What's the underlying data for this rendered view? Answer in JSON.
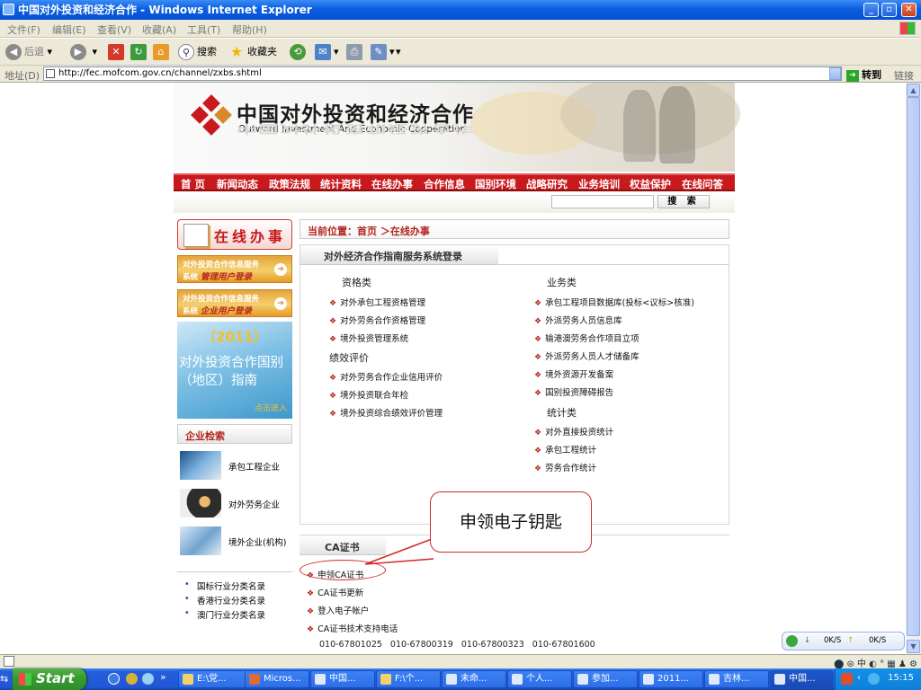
{
  "window": {
    "title": "中国对外投资和经济合作 - Windows Internet Explorer",
    "min": "_",
    "max": "▫",
    "close": "✕"
  },
  "menubar": [
    "文件(F)",
    "编辑(E)",
    "查看(V)",
    "收藏(A)",
    "工具(T)",
    "帮助(H)"
  ],
  "toolbar": {
    "back": "后退",
    "search": "搜索",
    "favorites": "收藏夹"
  },
  "address": {
    "label": "地址(D)",
    "url": "http://fec.mofcom.gov.cn/channel/zxbs.shtml",
    "go": "转到",
    "links": "链接"
  },
  "site": {
    "title_cn": "中国对外投资和经济合作",
    "title_en": "Outward Investment And Economic Cooperation",
    "nav": [
      "首 页",
      "新闻动态",
      "政策法规",
      "统计资料",
      "在线办事",
      "合作信息",
      "国别环境",
      "战略研究",
      "业务培训",
      "权益保护",
      "在线问答"
    ],
    "search_button": "搜 索"
  },
  "left": {
    "online_header": "在线办事",
    "login_manager": {
      "line1": "对外投资合作信息服务",
      "prefix": "系统",
      "emph": "管理用户登录"
    },
    "login_enterprise": {
      "line1": "对外投资合作信息服务",
      "prefix": "系统",
      "emph": "企业用户登录"
    },
    "guide": {
      "year": "（2011）",
      "line1": "对外投资合作国别",
      "line2": "（地区）指南",
      "more": "点击进入"
    },
    "enterprise_search": "企业检索",
    "enterprise_items": [
      "承包工程企业",
      "对外劳务企业",
      "境外企业(机构)"
    ],
    "categories": [
      "国标行业分类名录",
      "香港行业分类名录",
      "澳门行业分类名录"
    ]
  },
  "main": {
    "breadcrumb": "当前位置：首页 ＞在线办事",
    "panel_title": "对外经济合作指南服务系统登录",
    "qualification_title": "资格类",
    "qualification": [
      "对外承包工程资格管理",
      "对外劳务合作资格管理",
      "境外投资管理系统"
    ],
    "performance_title": "绩效评价",
    "performance": [
      "对外劳务合作企业信用评价",
      "境外投资联合年检",
      "境外投资综合绩效评价管理"
    ],
    "business_title": "业务类",
    "business": [
      "承包工程项目数据库(投标<议标>核准)",
      "外派劳务人员信息库",
      "输港澳劳务合作项目立项",
      "外派劳务人员人才储备库",
      "境外资源开发备案",
      "国别投资障碍报告"
    ],
    "stats_title": "统计类",
    "stats": [
      "对外直接投资统计",
      "承包工程统计",
      "劳务合作统计"
    ],
    "ca_title": "CA证书",
    "ca_items": [
      "申领CA证书",
      "CA证书更新",
      "登入电子帐户",
      "CA证书技术支持电话"
    ],
    "ca_phones": "010-67801025 010-67800319 010-67800323 010-67801600"
  },
  "callout": "申领电子钥匙",
  "download_widget": {
    "down": "0K/S",
    "up": "0K/S"
  },
  "taskbar": {
    "start": "Start",
    "tasks": [
      "E:\\党...",
      "Micros...",
      "中国...",
      "F:\\个...",
      "未命...",
      "个人...",
      "参加...",
      "2011...",
      "吉林...",
      "中国..."
    ],
    "clock": "15:15"
  },
  "colors": {
    "nav_red": "#c8191c",
    "accent_orange": "#e89a28",
    "callout_red": "#d12a2a"
  }
}
